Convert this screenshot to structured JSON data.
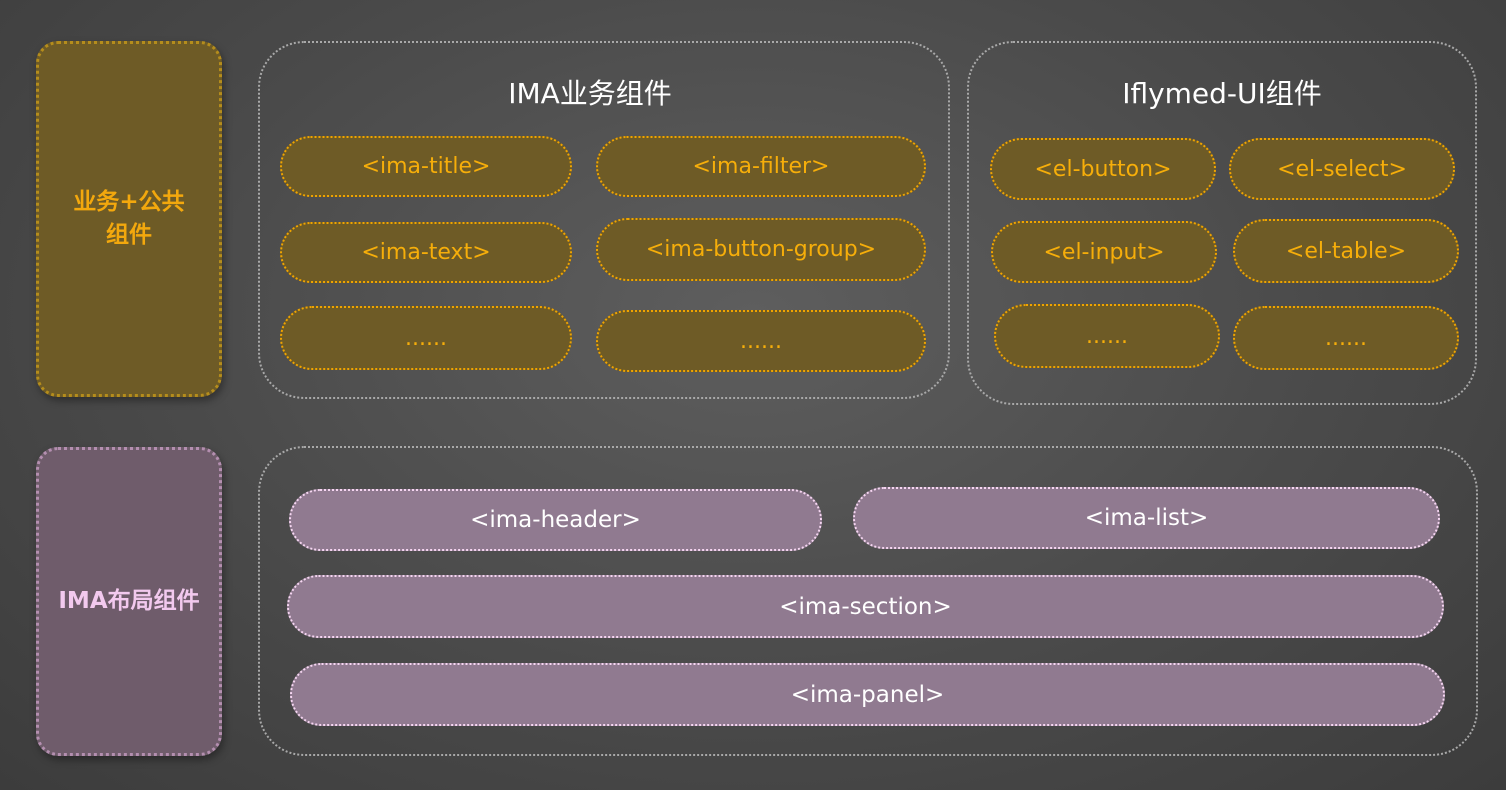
{
  "side": {
    "business": [
      "业务+公共",
      "组件"
    ],
    "layout": "IMA布局组件"
  },
  "groups": {
    "ima": {
      "title": "IMA业务组件",
      "items": [
        "<ima-title>",
        "<ima-filter>",
        "<ima-text>",
        "<ima-button-group>",
        "......",
        "......"
      ]
    },
    "iflymed": {
      "title": "Iflymed-UI组件",
      "items": [
        "<el-button>",
        "<el-select>",
        "<el-input>",
        "<el-table>",
        "......",
        "......"
      ]
    },
    "layout": {
      "items": [
        "<ima-header>",
        "<ima-list>",
        "<ima-section>",
        "<ima-panel>"
      ]
    }
  },
  "colors": {
    "background": "#4a4a4a",
    "gold_fill": "#6e5b26",
    "gold_text": "#f6ae0a",
    "pink_fill": "#907a90",
    "pink_text": "#ffffff",
    "pink_side_text": "#f2c9ee",
    "container_border": "#a9a9a9"
  }
}
